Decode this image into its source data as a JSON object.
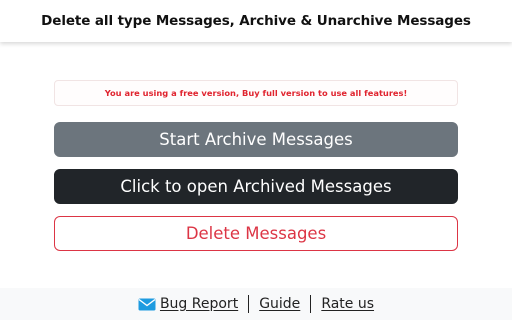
{
  "header": {
    "title": "Delete all type Messages, Archive & Unarchive Messages"
  },
  "notice": {
    "text": "You are using a free version, Buy full version to use all features!",
    "color": "#e0242f"
  },
  "buttons": {
    "archive_label": "Start Archive Messages",
    "open_archived_label": "Click to open Archived Messages",
    "delete_label": "Delete Messages"
  },
  "footer": {
    "bug_report_label": "Bug Report",
    "bug_report_icon": "mail-icon",
    "guide_label": "Guide",
    "rate_label": "Rate us"
  },
  "colors": {
    "archive_button": "#6c757d",
    "open_button": "#212529",
    "delete_button": "#dc3545",
    "mail_icon": "#1e9be0"
  }
}
